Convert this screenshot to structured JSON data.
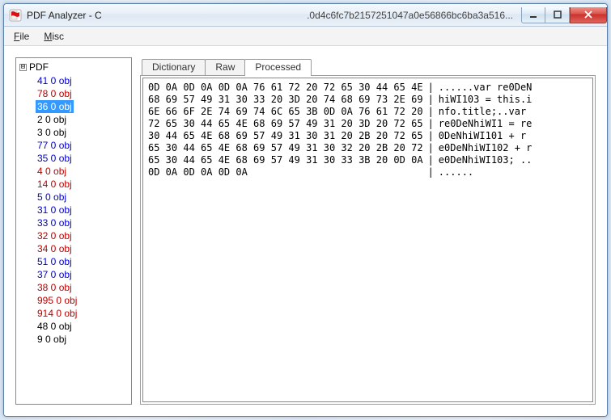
{
  "window": {
    "title": "PDF Analyzer - C",
    "title_extra": ".0d4c6fc7b2157251047a0e56866bc6ba3a516..."
  },
  "menubar": {
    "file_label": "File",
    "file_accel": "F",
    "misc_label": "Misc",
    "misc_accel": "M"
  },
  "tree": {
    "root_label": "PDF",
    "toggle_glyph": "⊟",
    "items": [
      {
        "label": "41 0 obj",
        "color": "blue",
        "selected": false
      },
      {
        "label": "78 0 obj",
        "color": "red",
        "selected": false
      },
      {
        "label": "36 0 obj",
        "color": "red",
        "selected": true
      },
      {
        "label": "2 0 obj",
        "color": "black",
        "selected": false
      },
      {
        "label": "3 0 obj",
        "color": "black",
        "selected": false
      },
      {
        "label": "77 0 obj",
        "color": "blue",
        "selected": false
      },
      {
        "label": "35 0 obj",
        "color": "blue",
        "selected": false
      },
      {
        "label": "4 0 obj",
        "color": "red",
        "selected": false
      },
      {
        "label": "14 0 obj",
        "color": "red",
        "selected": false
      },
      {
        "label": "5 0 obj",
        "color": "blue",
        "selected": false
      },
      {
        "label": "31 0 obj",
        "color": "blue",
        "selected": false
      },
      {
        "label": "33 0 obj",
        "color": "blue",
        "selected": false
      },
      {
        "label": "32 0 obj",
        "color": "red",
        "selected": false
      },
      {
        "label": "34 0 obj",
        "color": "red",
        "selected": false
      },
      {
        "label": "51 0 obj",
        "color": "blue",
        "selected": false
      },
      {
        "label": "37 0 obj",
        "color": "blue",
        "selected": false
      },
      {
        "label": "38 0 obj",
        "color": "red",
        "selected": false
      },
      {
        "label": "995 0 obj",
        "color": "red",
        "selected": false
      },
      {
        "label": "914 0 obj",
        "color": "red",
        "selected": false
      },
      {
        "label": "48 0 obj",
        "color": "black",
        "selected": false
      },
      {
        "label": "9 0 obj",
        "color": "black",
        "selected": false
      }
    ]
  },
  "tabs": {
    "items": [
      {
        "label": "Dictionary",
        "active": false
      },
      {
        "label": "Raw",
        "active": false
      },
      {
        "label": "Processed",
        "active": true
      }
    ]
  },
  "hex": {
    "rows": [
      {
        "bytes": "0D 0A 0D 0A 0D 0A 76 61 72 20 72 65 30 44 65 4E",
        "ascii": "......var re0DeN"
      },
      {
        "bytes": "68 69 57 49 31 30 33 20 3D 20 74 68 69 73 2E 69",
        "ascii": "hiWI103 = this.i"
      },
      {
        "bytes": "6E 66 6F 2E 74 69 74 6C 65 3B 0D 0A 76 61 72 20",
        "ascii": "nfo.title;..var "
      },
      {
        "bytes": "72 65 30 44 65 4E 68 69 57 49 31 20 3D 20 72 65",
        "ascii": "re0DeNhiWI1 = re"
      },
      {
        "bytes": "30 44 65 4E 68 69 57 49 31 30 31 20 2B 20 72 65",
        "ascii": "0DeNhiWI101 + r"
      },
      {
        "bytes": "65 30 44 65 4E 68 69 57 49 31 30 32 20 2B 20 72",
        "ascii": "e0DeNhiWI102 + r"
      },
      {
        "bytes": "65 30 44 65 4E 68 69 57 49 31 30 33 3B 20 0D 0A",
        "ascii": "e0DeNhiWI103; .."
      },
      {
        "bytes": "0D 0A 0D 0A 0D 0A",
        "ascii": "......"
      }
    ]
  }
}
